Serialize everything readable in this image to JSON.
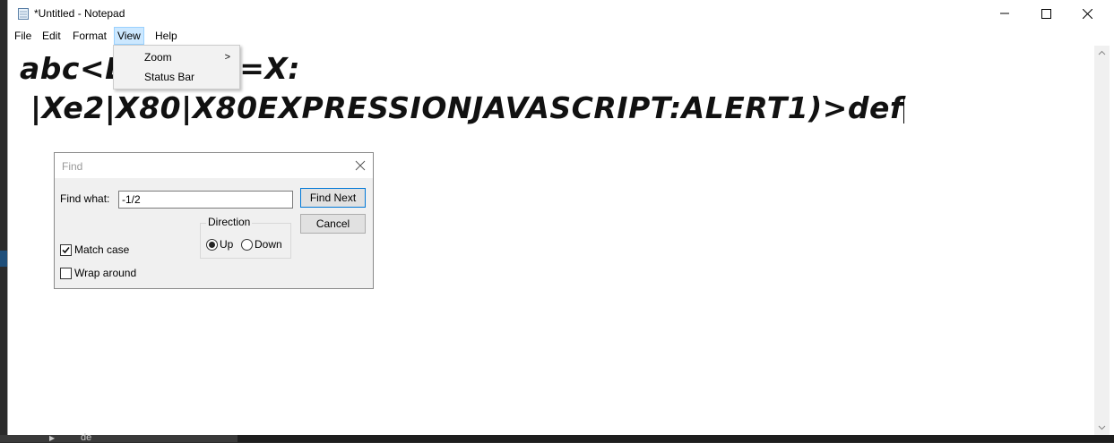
{
  "window": {
    "title": "*Untitled - Notepad"
  },
  "menu": {
    "items": [
      {
        "label": "File"
      },
      {
        "label": "Edit"
      },
      {
        "label": "Format"
      },
      {
        "label": "View"
      },
      {
        "label": "Help"
      }
    ],
    "view_dropdown": [
      {
        "label": "Zoom",
        "submenu_arrow": ">"
      },
      {
        "label": "Status Bar"
      }
    ]
  },
  "editor": {
    "line1": "abc<L",
    "line1_tail": "LE=X:",
    "line2": " |Xe2|X80|X80EXPRESSIONJAVASCRIPT:ALERT1)>def"
  },
  "find_dialog": {
    "title": "Find",
    "find_what_label": "Find what:",
    "find_what_value": "-1/2",
    "find_next_label": "Find Next",
    "cancel_label": "Cancel",
    "direction_label": "Direction",
    "up_label": "Up",
    "down_label": "Down",
    "match_case_label": "Match case",
    "wrap_around_label": "Wrap around",
    "match_case_checked": true,
    "wrap_around_checked": false,
    "direction_selected": "Up"
  },
  "background": {
    "taskbar_text": "de"
  },
  "colors": {
    "menu_highlight": "#cce8ff",
    "dialog_bg": "#f0f0f0",
    "default_button_border": "#0078d7"
  }
}
